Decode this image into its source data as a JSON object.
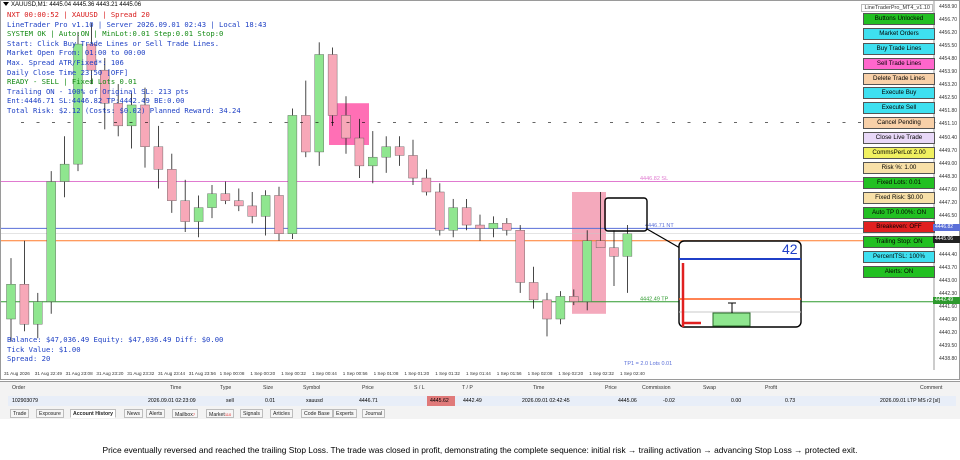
{
  "window": {
    "title": "XAUUSD,M1: 4445.04 4445.36 4443.21 4445.06",
    "ea_badge": "LineTraderPro_MT4_v1.10"
  },
  "status_panel": {
    "lines": [
      {
        "text": "NXT 00:00:52 | XAUUSD | Spread 20",
        "color": "#d81b1b"
      },
      {
        "text": "LineTrader Pro v1.10 | Server 2026.09.01 02:43 | Local 18:43",
        "color": "#1d3fc4"
      },
      {
        "text": "SYSTEM OK | Auto:ON | MinLot:0.01 Step:0.01 Stop:0",
        "color": "#138a13"
      },
      {
        "text": "Start: Click Buy Trade Lines or Sell Trade Lines.",
        "color": "#1d3fc4"
      },
      {
        "text": "Market Open From: 01:00 to 00:00",
        "color": "#1d3fc4"
      },
      {
        "text": "Max. Spread ATR/Fixed*: 106",
        "color": "#1d3fc4"
      },
      {
        "text": "Daily Close Time 23:50 [OFF]",
        "color": "#1d3fc4"
      },
      {
        "text": "READY - SELL | Fixed Lots 0.01",
        "color": "#138a13"
      },
      {
        "text": "Trailing ON - 100% of Original SL: 213 pts",
        "color": "#1d3fc4"
      },
      {
        "text": "Ent:4446.71 SL:4446.82 TP:4442.49 BE:0.00",
        "color": "#1d3fc4"
      },
      {
        "text": "Total Risk: $2.12 (Costs: $0.02) Planned Reward: 34.24",
        "color": "#1d3fc4"
      }
    ],
    "bottom_lines": [
      "Balance: $47,036.49 Equity: $47,036.49 Diff: $0.00",
      "Tick Value: $1.00",
      "Spread: 20"
    ]
  },
  "panel_buttons": [
    {
      "label": "Buttons Unlocked",
      "bg": "#22c022",
      "fg": "#000000"
    },
    {
      "label": "Market Orders",
      "bg": "#3ee0f0",
      "fg": "#000000"
    },
    {
      "label": "Buy Trade Lines",
      "bg": "#3ee0f0",
      "fg": "#000000"
    },
    {
      "label": "Sell Trade Lines",
      "bg": "#ff66cc",
      "fg": "#000000"
    },
    {
      "label": "Delete Trade Lines",
      "bg": "#f8d0a8",
      "fg": "#000000"
    },
    {
      "label": "Execute Buy",
      "bg": "#3ee0f0",
      "fg": "#000000"
    },
    {
      "label": "Execute Sell",
      "bg": "#3ee0f0",
      "fg": "#000000"
    },
    {
      "label": "Cancel Pending",
      "bg": "#f8d0a8",
      "fg": "#000000"
    },
    {
      "label": "Close Live Trade",
      "bg": "#e8d8f8",
      "fg": "#000000"
    },
    {
      "label": "CommsPerLot 2.00",
      "bg": "#f0f060",
      "fg": "#000000"
    },
    {
      "label": "Risk %: 1.00",
      "bg": "#f8e0a8",
      "fg": "#000000"
    },
    {
      "label": "Fixed Lots: 0.01",
      "bg": "#22c022",
      "fg": "#000000"
    },
    {
      "label": "Fixed Risk: $0.00",
      "bg": "#f8e0a8",
      "fg": "#000000"
    },
    {
      "label": "Auto TP 0.00%: ON",
      "bg": "#22c022",
      "fg": "#000000"
    },
    {
      "label": "Breakeven: OFF",
      "bg": "#e02020",
      "fg": "#000000"
    },
    {
      "label": "Trailing Stop: ON",
      "bg": "#22c022",
      "fg": "#000000"
    },
    {
      "label": "PercentTSL: 100%",
      "bg": "#3ee0f0",
      "fg": "#000000"
    },
    {
      "label": "Alerts: ON",
      "bg": "#22c022",
      "fg": "#000000"
    }
  ],
  "price_axis": {
    "labels": [
      "4458.90",
      "4456.70",
      "4456.20",
      "4455.50",
      "4454.80",
      "4453.90",
      "4453.20",
      "4452.50",
      "4451.80",
      "4451.10",
      "4450.40",
      "4449.70",
      "4449.00",
      "4448.30",
      "4447.60",
      "4447.20",
      "4446.50",
      "4445.80",
      "4445.10",
      "4444.40",
      "4443.70",
      "4443.00",
      "4442.30",
      "4441.60",
      "4440.90",
      "4440.20",
      "4439.50",
      "4438.80"
    ],
    "current_price": "4445.06",
    "sl_price": "4446.82",
    "tp_price": "4442.49"
  },
  "chart_annotations": {
    "sl_label": "4446.82 SL",
    "entry_label": "4446.71 NT",
    "tp_label": "4442.49 TP",
    "tp_note": "TP1 = 2.0 Lots 0.01",
    "zoom_number": "42"
  },
  "time_axis": [
    "31 Aug 2026",
    "31 Aug 22:49",
    "31 Aug 23:08",
    "31 Aug 23:20",
    "31 Aug 23:32",
    "31 Aug 23:44",
    "31 Aug 23:56",
    "1 Sep 00:08",
    "1 Sep 00:20",
    "1 Sep 00:32",
    "1 Sep 00:44",
    "1 Sep 00:56",
    "1 Sep 01:08",
    "1 Sep 01:20",
    "1 Sep 01:32",
    "1 Sep 01:44",
    "1 Sep 01:56",
    "1 Sep 02:08",
    "1 Sep 02:20",
    "1 Sep 02:32",
    "1 Sep 02:40"
  ],
  "terminal": {
    "headers": [
      "Order",
      "Time",
      "Type",
      "Size",
      "Symbol",
      "Price",
      "S / L",
      "T / P",
      "Time",
      "Price",
      "Commission",
      "Swap",
      "Profit",
      "Comment"
    ],
    "row": [
      "102903079",
      "2026.09.01 02:23:09",
      "sell",
      "0.01",
      "xauusd",
      "4446.71",
      "4445.62",
      "4442.49",
      "2026.09.01 02:42:45",
      "4445.06",
      "-0.02",
      "0.00",
      "0.73",
      "2026.09.01 LTP MS r2 [sl]"
    ],
    "tabs": [
      "Trade",
      "Exposure",
      "Account History",
      "News",
      "Alerts",
      "Mailbox",
      "Market",
      "Signals",
      "Articles",
      "Code Base",
      "Experts",
      "Journal"
    ],
    "active_tab": "Account History",
    "tab_badges": {
      "mailbox": "7",
      "market": "110"
    }
  },
  "caption": "Price eventually reversed and reached the trailing Stop Loss. The trade was closed in profit, demonstrating the complete sequence: initial risk → trailing activation → advancing Stop Loss → protected exit.",
  "chart_data": {
    "type": "candlestick",
    "symbol": "XAUUSD",
    "timeframe": "M1",
    "levels": {
      "stop_loss": 4446.82,
      "entry": 4446.71,
      "take_profit": 4442.49,
      "current": 4445.06
    },
    "ylim": [
      4438.8,
      4459.2
    ],
    "colors": {
      "bull": "#8fe68f",
      "bear": "#f7a8b8",
      "sl_line": "#e07ad0",
      "entry_line": "#5a6fd8",
      "tp_line": "#2e9a2e",
      "orange_line": "#ff7a2a"
    },
    "candles": [
      {
        "o": 4441.5,
        "h": 4445.0,
        "l": 4440.2,
        "c": 4443.5
      },
      {
        "o": 4443.5,
        "h": 4446.0,
        "l": 4440.8,
        "c": 4441.2
      },
      {
        "o": 4441.2,
        "h": 4443.0,
        "l": 4440.4,
        "c": 4442.5
      },
      {
        "o": 4442.5,
        "h": 4450.0,
        "l": 4441.8,
        "c": 4449.4
      },
      {
        "o": 4449.4,
        "h": 4452.0,
        "l": 4448.5,
        "c": 4450.4
      },
      {
        "o": 4450.4,
        "h": 4458.0,
        "l": 4450.0,
        "c": 4457.3
      },
      {
        "o": 4457.3,
        "h": 4458.5,
        "l": 4455.0,
        "c": 4455.8
      },
      {
        "o": 4455.8,
        "h": 4456.5,
        "l": 4452.4,
        "c": 4453.9
      },
      {
        "o": 4453.9,
        "h": 4455.0,
        "l": 4452.0,
        "c": 4452.6
      },
      {
        "o": 4452.6,
        "h": 4454.5,
        "l": 4451.3,
        "c": 4453.8
      },
      {
        "o": 4453.8,
        "h": 4454.8,
        "l": 4450.2,
        "c": 4451.4
      },
      {
        "o": 4451.4,
        "h": 4452.6,
        "l": 4449.0,
        "c": 4450.1
      },
      {
        "o": 4450.1,
        "h": 4451.0,
        "l": 4447.6,
        "c": 4448.3
      },
      {
        "o": 4448.3,
        "h": 4449.5,
        "l": 4446.5,
        "c": 4447.1
      },
      {
        "o": 4447.1,
        "h": 4448.6,
        "l": 4446.2,
        "c": 4447.9
      },
      {
        "o": 4447.9,
        "h": 4449.2,
        "l": 4447.3,
        "c": 4448.7
      },
      {
        "o": 4448.7,
        "h": 4449.4,
        "l": 4448.1,
        "c": 4448.3
      },
      {
        "o": 4448.3,
        "h": 4449.0,
        "l": 4447.7,
        "c": 4448.0
      },
      {
        "o": 4448.0,
        "h": 4448.8,
        "l": 4447.0,
        "c": 4447.4
      },
      {
        "o": 4447.4,
        "h": 4448.9,
        "l": 4446.3,
        "c": 4448.6
      },
      {
        "o": 4448.6,
        "h": 4449.1,
        "l": 4446.0,
        "c": 4446.4
      },
      {
        "o": 4446.4,
        "h": 4453.6,
        "l": 4446.1,
        "c": 4453.2
      },
      {
        "o": 4453.2,
        "h": 4455.2,
        "l": 4450.8,
        "c": 4451.1
      },
      {
        "o": 4451.1,
        "h": 4457.4,
        "l": 4450.3,
        "c": 4456.7
      },
      {
        "o": 4456.7,
        "h": 4457.1,
        "l": 4452.6,
        "c": 4453.2
      },
      {
        "o": 4453.2,
        "h": 4454.3,
        "l": 4451.0,
        "c": 4451.9
      },
      {
        "o": 4451.9,
        "h": 4453.0,
        "l": 4449.6,
        "c": 4450.3
      },
      {
        "o": 4450.3,
        "h": 4452.3,
        "l": 4449.3,
        "c": 4450.8
      },
      {
        "o": 4450.8,
        "h": 4452.0,
        "l": 4449.9,
        "c": 4451.4
      },
      {
        "o": 4451.4,
        "h": 4452.0,
        "l": 4450.3,
        "c": 4450.9
      },
      {
        "o": 4450.9,
        "h": 4451.8,
        "l": 4449.2,
        "c": 4449.6
      },
      {
        "o": 4449.6,
        "h": 4450.1,
        "l": 4448.6,
        "c": 4448.8
      },
      {
        "o": 4448.8,
        "h": 4449.3,
        "l": 4446.3,
        "c": 4446.6
      },
      {
        "o": 4446.6,
        "h": 4448.4,
        "l": 4446.2,
        "c": 4447.9
      },
      {
        "o": 4447.9,
        "h": 4448.4,
        "l": 4446.6,
        "c": 4446.9
      },
      {
        "o": 4446.9,
        "h": 4447.5,
        "l": 4446.0,
        "c": 4446.7
      },
      {
        "o": 4446.7,
        "h": 4447.4,
        "l": 4446.2,
        "c": 4447.0
      },
      {
        "o": 4447.0,
        "h": 4447.3,
        "l": 4446.3,
        "c": 4446.6
      },
      {
        "o": 4446.6,
        "h": 4446.9,
        "l": 4443.0,
        "c": 4443.6
      },
      {
        "o": 4443.6,
        "h": 4444.5,
        "l": 4442.1,
        "c": 4442.6
      },
      {
        "o": 4442.6,
        "h": 4443.0,
        "l": 4440.5,
        "c": 4441.5
      },
      {
        "o": 4441.5,
        "h": 4443.1,
        "l": 4441.2,
        "c": 4442.8
      },
      {
        "o": 4442.8,
        "h": 4443.2,
        "l": 4442.3,
        "c": 4442.5
      },
      {
        "o": 4442.5,
        "h": 4446.6,
        "l": 4442.0,
        "c": 4446.0
      },
      {
        "o": 4446.0,
        "h": 4448.8,
        "l": 4445.6,
        "c": 4445.6
      },
      {
        "o": 4445.6,
        "h": 4446.6,
        "l": 4443.4,
        "c": 4445.1
      },
      {
        "o": 4445.1,
        "h": 4446.9,
        "l": 4443.0,
        "c": 4446.4
      }
    ]
  }
}
